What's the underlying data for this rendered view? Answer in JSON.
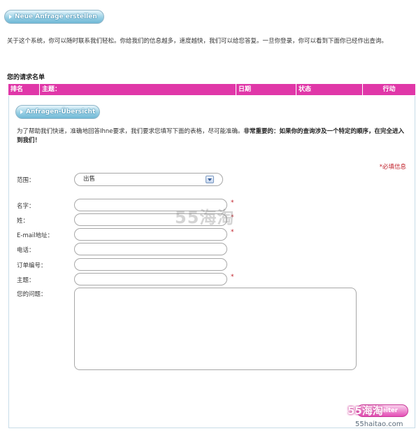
{
  "top_button": {
    "label": "Neue Anfrage erstellen"
  },
  "intro_text": "关于这个系统，你可以随时联系我们轻松。你给我们的信息越多，速度越快，我们可以给您答复。一旦你登录，你可以看到下面你已经作出查询。",
  "requests_title": "您的请求名单",
  "table_header": {
    "columns": [
      "排名",
      "主题：",
      "日期",
      "状态",
      "行动"
    ]
  },
  "overview_button": {
    "label": "Anfragen-Übersicht"
  },
  "notice": {
    "normal": "为了帮助我们快速，准确地回答Ihne要求，我们要求您填写下面的表格，尽可能准确。",
    "bold": "非常重要的：如果你的查询涉及一个特定的顺序，在完全进入到我们！"
  },
  "required_note": "*必填信息",
  "form": {
    "range_label": "范围：",
    "range_value": "出售",
    "name_label": "名字：",
    "surname_label": "姓：",
    "email_label": "E-mail地址：",
    "phone_label": "电话：",
    "order_label": "订单编号：",
    "subject_label": "主题：",
    "question_label": "您的问题：",
    "required_star": "*"
  },
  "submit_button": {
    "label": "Weiter"
  },
  "watermark": {
    "center": "55海淘",
    "logo": "55海淘",
    "url": "55haitao.com"
  },
  "colors": {
    "accent": "#e037a8",
    "button_blue": "#6fb8d6",
    "required_red": "#c0202a"
  }
}
